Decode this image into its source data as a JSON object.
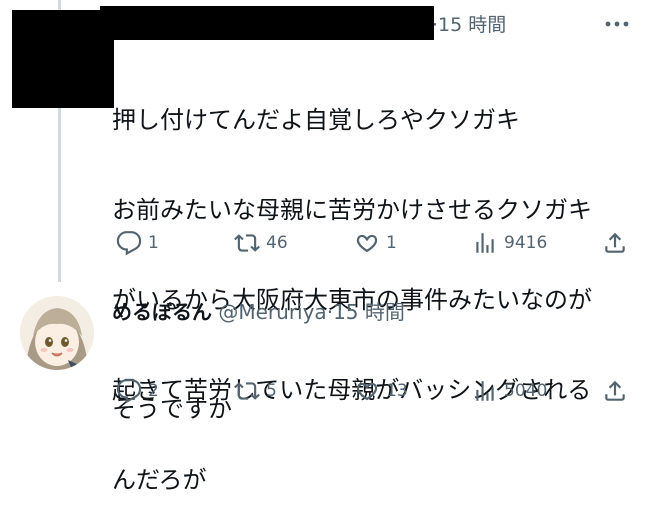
{
  "tweet1": {
    "timestamp": "15 時間",
    "lines": [
      "押し付けてんだよ自覚しろやクソガキ",
      "お前みたいな母親に苦労かけさせるクソガキ",
      "がいるから大阪府大東市の事件みたいなのが",
      "起きて苦労していた母親がバッシングされる",
      "んだろが"
    ],
    "replies": "1",
    "retweets": "46",
    "likes": "1",
    "views": "9416"
  },
  "tweet2": {
    "display_name": "めるぼるん",
    "handle": "@Meruriya",
    "separator": "·",
    "timestamp": "15 時間",
    "text": "そうですか",
    "replies": "2",
    "retweets": "5",
    "likes": "13",
    "views": "5040"
  },
  "icons": [
    "more-icon",
    "reply-icon",
    "retweet-icon",
    "like-icon",
    "views-icon",
    "share-icon"
  ],
  "colors": {
    "text": "#0f1419",
    "secondary": "#536471",
    "thread_line": "#cfd9de",
    "redaction": "#000000"
  }
}
